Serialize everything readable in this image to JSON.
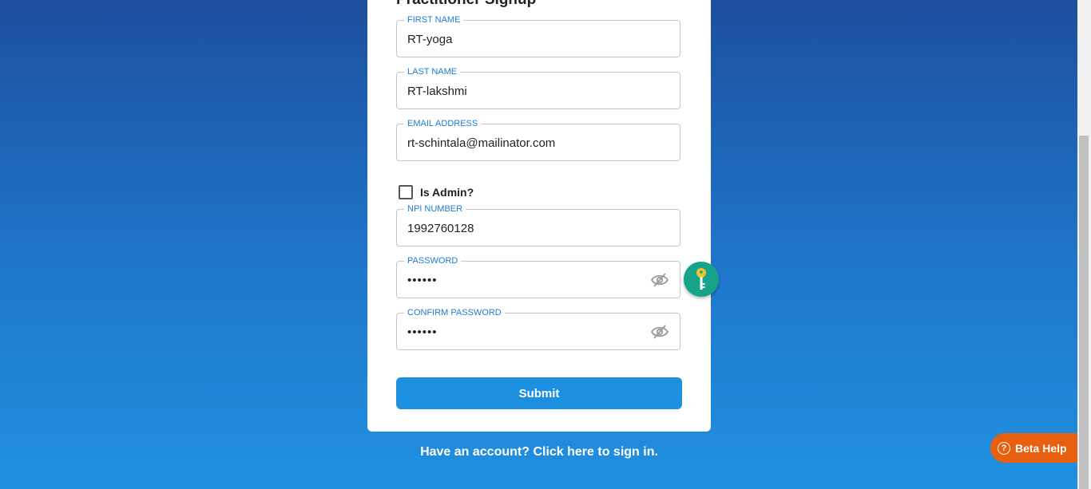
{
  "form": {
    "title": "Practitioner Signup",
    "first_name": {
      "label": "FIRST NAME",
      "value": "RT-yoga"
    },
    "last_name": {
      "label": "LAST NAME",
      "value": "RT-lakshmi"
    },
    "email": {
      "label": "EMAIL ADDRESS",
      "value": "rt-schintala@mailinator.com"
    },
    "is_admin": {
      "label": "Is Admin?",
      "checked": false
    },
    "npi": {
      "label": "NPI NUMBER",
      "value": "1992760128"
    },
    "password": {
      "label": "PASSWORD",
      "value": "••••••"
    },
    "confirm_password": {
      "label": "CONFIRM PASSWORD",
      "value": "••••••"
    },
    "submit_label": "Submit"
  },
  "signin_link": "Have an account? Click here to sign in.",
  "beta_help": {
    "label": "Beta Help",
    "icon": "?"
  },
  "colors": {
    "accent": "#1d8fe0",
    "label": "#1f7bd0",
    "beta_help_bg": "#e8600f",
    "key_badge_bg": "#17a38a"
  },
  "icons": [
    "eye-slash-icon",
    "key-icon",
    "help-circle-icon"
  ]
}
